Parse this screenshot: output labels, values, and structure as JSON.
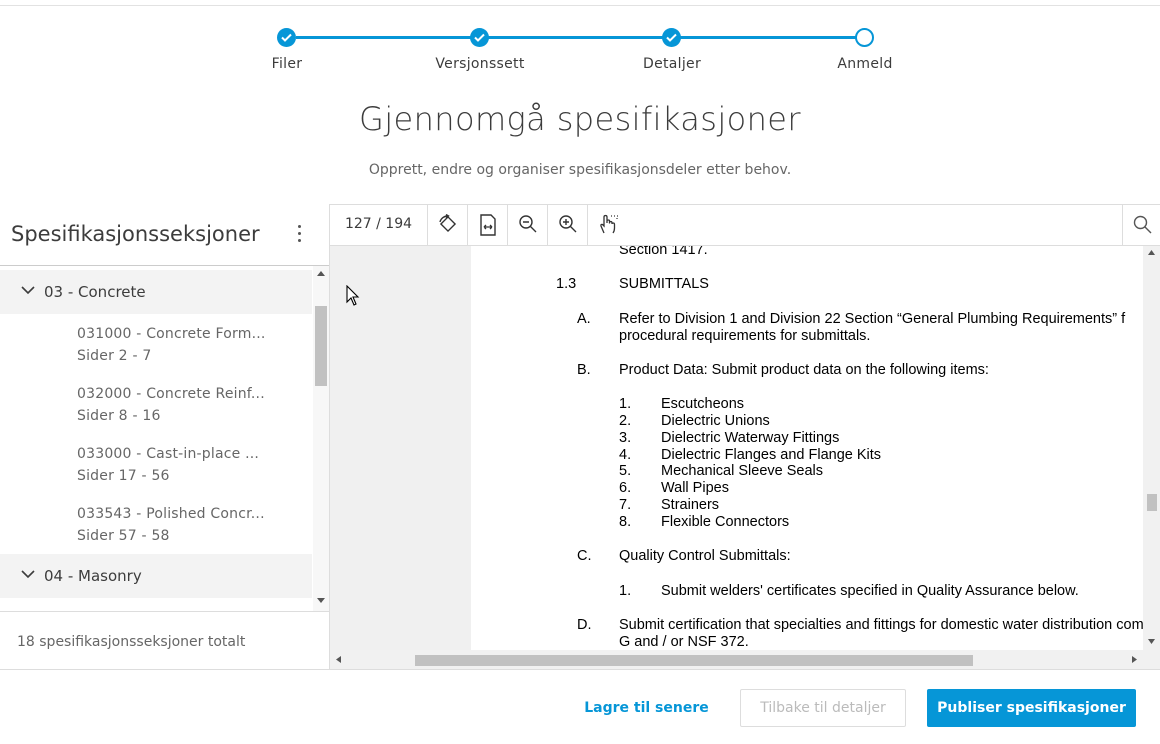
{
  "stepper": {
    "steps": [
      {
        "label": "Filer",
        "state": "done"
      },
      {
        "label": "Versjonssett",
        "state": "done"
      },
      {
        "label": "Detaljer",
        "state": "done"
      },
      {
        "label": "Anmeld",
        "state": "current"
      }
    ]
  },
  "header": {
    "title": "Gjennomgå spesifikasjoner",
    "subtitle": "Opprett, endre og organiser spesifikasjonsdeler etter behov."
  },
  "sidebar": {
    "title": "Spesifikasjonsseksjoner",
    "groups": [
      {
        "label": "03 - Concrete",
        "items": [
          {
            "name": "031000 - Concrete Form...",
            "pages": "Sider 2 - 7"
          },
          {
            "name": "032000 - Concrete Reinf...",
            "pages": "Sider 8 - 16"
          },
          {
            "name": "033000 - Cast-in-place ...",
            "pages": "Sider 17 - 56"
          },
          {
            "name": "033543 - Polished Concr...",
            "pages": "Sider 57 - 58"
          }
        ]
      },
      {
        "label": "04 - Masonry",
        "items": []
      }
    ],
    "footer_text": "18 spesifikasjonsseksjoner totalt"
  },
  "viewer": {
    "page_indicator": "127 / 194",
    "tools": [
      "rotate-icon",
      "fit-width-icon",
      "zoom-out-icon",
      "zoom-in-icon",
      "pan-hand-icon"
    ],
    "document": {
      "lines": [
        "Section 1417.",
        "1.3",
        "SUBMITTALS",
        "A.",
        "Refer to Division 1 and Division 22 Section “General Plumbing Requirements” f",
        "procedural requirements for submittals.",
        "B.",
        "Product Data:  Submit product data on the following items:",
        "1.",
        "Escutcheons",
        "2.",
        "Dielectric Unions",
        "3.",
        "Dielectric Waterway Fittings",
        "4.",
        "Dielectric Flanges and Flange Kits",
        "5.",
        "Mechanical Sleeve Seals",
        "6.",
        "Wall Pipes",
        "7.",
        "Strainers",
        "8.",
        "Flexible Connectors",
        "C.",
        "Quality Control Submittals:",
        "1.",
        "Submit welders' certificates specified in Quality Assurance below.",
        "D.",
        "Submit certification that specialties and fittings for domestic water distribution comp",
        "G and / or NSF 372."
      ]
    }
  },
  "footer": {
    "save_later": "Lagre til senere",
    "back": "Tilbake til detaljer",
    "publish": "Publiser spesifikasjoner"
  },
  "colors": {
    "accent": "#0696d7"
  }
}
